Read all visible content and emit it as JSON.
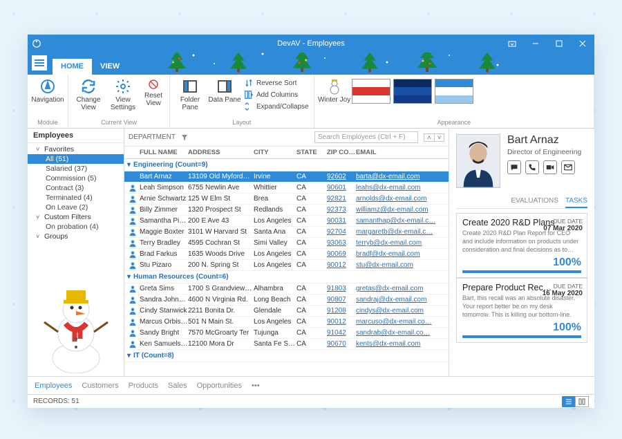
{
  "window": {
    "title": "DevAV - Employees"
  },
  "ribbonTabs": [
    "HOME",
    "VIEW"
  ],
  "ribbon": {
    "module": {
      "label": "Module",
      "items": [
        {
          "label": "Navigation"
        }
      ]
    },
    "currentView": {
      "label": "Current View",
      "items": [
        {
          "label": "Change View"
        },
        {
          "label": "View Settings"
        },
        {
          "label": "Reset View"
        }
      ]
    },
    "layout": {
      "label": "Layout",
      "items": [
        {
          "label": "Folder Pane"
        },
        {
          "label": "Data Pane"
        }
      ],
      "small": [
        "Reverse Sort",
        "Add Columns",
        "Expand/Collapse"
      ]
    },
    "appearance": {
      "label": "Appearance",
      "theme": "Winter Joy"
    }
  },
  "sidebar": {
    "header": "Employees",
    "groups": [
      {
        "label": "Favorites",
        "items": [
          {
            "label": "All (51)",
            "sel": true
          },
          {
            "label": "Salaried (37)"
          },
          {
            "label": "Commission (5)"
          },
          {
            "label": "Contract (3)"
          },
          {
            "label": "Terminated (4)"
          },
          {
            "label": "On Leave (2)"
          }
        ]
      },
      {
        "label": "Custom Filters",
        "items": [
          {
            "label": "On probation  (4)"
          }
        ]
      },
      {
        "label": "Groups",
        "items": []
      }
    ]
  },
  "grid": {
    "groupBy": "DEPARTMENT",
    "searchPlaceholder": "Search Employees (Ctrl + F)",
    "columns": [
      "FULL NAME",
      "ADDRESS",
      "CITY",
      "STATE",
      "ZIP CO…",
      "EMAIL"
    ],
    "groups": [
      {
        "title": "Engineering (Count=9)",
        "rows": [
          {
            "name": "Bart Arnaz",
            "addr": "13109 Old Myford…",
            "city": "Irvine",
            "state": "CA",
            "zip": "92602",
            "email": "barta@dx-email.com",
            "sel": true
          },
          {
            "name": "Leah Simpson",
            "addr": "6755 Newlin Ave",
            "city": "Whittier",
            "state": "CA",
            "zip": "90601",
            "email": "leahs@dx-email.com"
          },
          {
            "name": "Arnie Schwartz",
            "addr": "125 W Elm St",
            "city": "Brea",
            "state": "CA",
            "zip": "92821",
            "email": "arnolds@dx-email.com"
          },
          {
            "name": "Billy Zimmer",
            "addr": "1320 Prospect St",
            "city": "Redlands",
            "state": "CA",
            "zip": "92373",
            "email": "williamz@dx-email.com"
          },
          {
            "name": "Samantha Piper",
            "addr": "200 E Ave 43",
            "city": "Los Angeles",
            "state": "CA",
            "zip": "90031",
            "email": "samanthap@dx-email.c…"
          },
          {
            "name": "Maggie Boxter",
            "addr": "3101 W Harvard St",
            "city": "Santa Ana",
            "state": "CA",
            "zip": "92704",
            "email": "margaretb@dx-email.c…"
          },
          {
            "name": "Terry Bradley",
            "addr": "4595 Cochran St",
            "city": "Simi Valley",
            "state": "CA",
            "zip": "93063",
            "email": "terryb@dx-email.com"
          },
          {
            "name": "Brad Farkus",
            "addr": "1635 Woods Drive",
            "city": "Los Angeles",
            "state": "CA",
            "zip": "90069",
            "email": "bradf@dx-email.com"
          },
          {
            "name": "Stu Pizaro",
            "addr": "200 N. Spring St",
            "city": "Los Angeles",
            "state": "CA",
            "zip": "90012",
            "email": "stu@dx-email.com"
          }
        ]
      },
      {
        "title": "Human Resources (Count=6)",
        "rows": [
          {
            "name": "Greta Sims",
            "addr": "1700 S Grandview…",
            "city": "Alhambra",
            "state": "CA",
            "zip": "91803",
            "email": "gretas@dx-email.com"
          },
          {
            "name": "Sandra Johnson",
            "addr": "4600 N Virginia Rd.",
            "city": "Long Beach",
            "state": "CA",
            "zip": "90807",
            "email": "sandraj@dx-email.com"
          },
          {
            "name": "Cindy Stanwick",
            "addr": "2211 Bonita Dr.",
            "city": "Glendale",
            "state": "CA",
            "zip": "91208",
            "email": "cindys@dx-email.com"
          },
          {
            "name": "Marcus Orbison",
            "addr": "501 N Main St.",
            "city": "Los Angeles",
            "state": "CA",
            "zip": "90012",
            "email": "marcuso@dx-email.co…"
          },
          {
            "name": "Sandy Bright",
            "addr": "7570 McGroarty Ter",
            "city": "Tujunga",
            "state": "CA",
            "zip": "91042",
            "email": "sandrab@dx-email.co…"
          },
          {
            "name": "Ken Samuelson",
            "addr": "12100 Mora Dr",
            "city": "Santa Fe Sprin…",
            "state": "CA",
            "zip": "90670",
            "email": "kents@dx-email.com"
          }
        ]
      },
      {
        "title": "IT (Count=8)",
        "rows": []
      }
    ]
  },
  "detail": {
    "name": "Bart Arnaz",
    "role": "Director of Engineering",
    "tabs": [
      "EVALUATIONS",
      "TASKS"
    ],
    "activeTab": 1,
    "tasks": [
      {
        "title": "Create 2020 R&D Plans",
        "due": "07 Mar 2020",
        "desc": "Create 2020 R&D Plan Report for CEO and include information on products under consideration and final decisions as to…",
        "pct": "100%"
      },
      {
        "title": "Prepare Product Rec…",
        "due": "16 May 2020",
        "desc": "Bart, this recall was an absolute disaster. Your report better be on my desk tomorrow. This is killing our bottom-line.",
        "pct": "100%"
      }
    ]
  },
  "bottomNav": [
    "Employees",
    "Customers",
    "Products",
    "Sales",
    "Opportunities"
  ],
  "status": {
    "records": "RECORDS: 51"
  }
}
